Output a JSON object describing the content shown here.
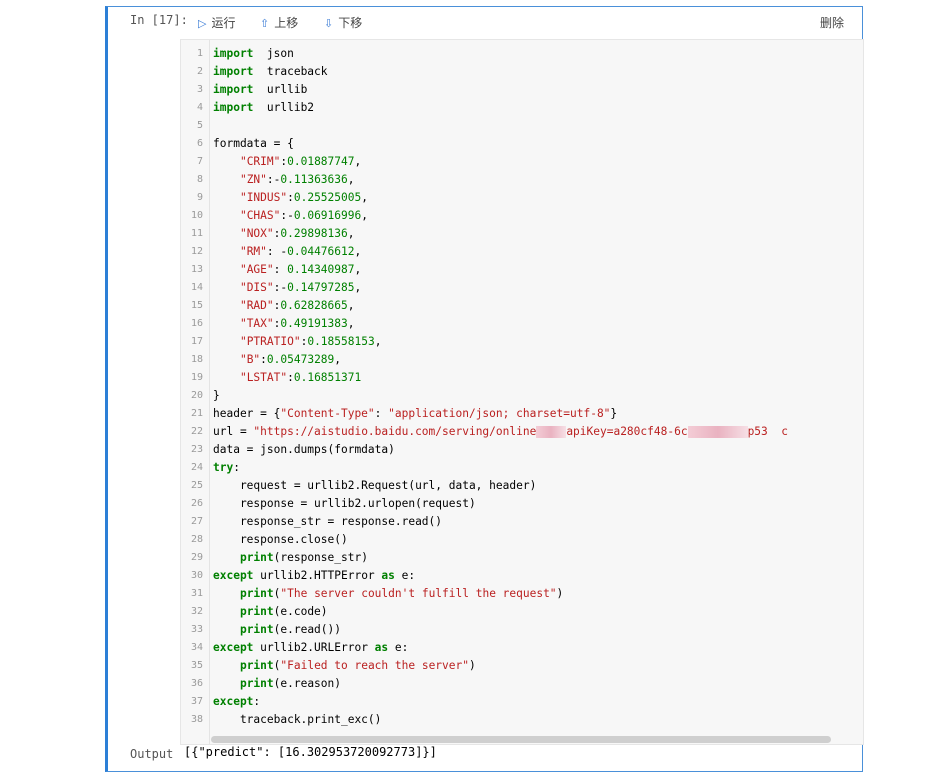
{
  "cell": {
    "in_prompt": "In [17]:",
    "out_prompt": "Output",
    "toolbar": {
      "run_label": "运行",
      "move_up_label": "上移",
      "move_down_label": "下移",
      "delete_label": "删除",
      "run_icon": "play-icon",
      "up_icon": "arrow-up-icon",
      "down_icon": "arrow-down-icon"
    },
    "output_text": "[{\"predict\": [16.302953720092773]}]"
  },
  "code_lines": [
    {
      "n": "1",
      "segs": [
        [
          "kw",
          "import"
        ],
        [
          "",
          "  json"
        ]
      ]
    },
    {
      "n": "2",
      "segs": [
        [
          "kw",
          "import"
        ],
        [
          "",
          "  traceback"
        ]
      ]
    },
    {
      "n": "3",
      "segs": [
        [
          "kw",
          "import"
        ],
        [
          "",
          "  urllib"
        ]
      ]
    },
    {
      "n": "4",
      "segs": [
        [
          "kw",
          "import"
        ],
        [
          "",
          "  urllib2"
        ]
      ]
    },
    {
      "n": "5",
      "segs": []
    },
    {
      "n": "6",
      "segs": [
        [
          "",
          "formdata = {"
        ]
      ]
    },
    {
      "n": "7",
      "segs": [
        [
          "",
          "    "
        ],
        [
          "str",
          "\"CRIM\""
        ],
        [
          "",
          ":"
        ],
        [
          "num",
          "0.01887747"
        ],
        [
          "",
          ","
        ]
      ]
    },
    {
      "n": "8",
      "segs": [
        [
          "",
          "    "
        ],
        [
          "str",
          "\"ZN\""
        ],
        [
          "",
          ":-"
        ],
        [
          "num",
          "0.11363636"
        ],
        [
          "",
          ","
        ]
      ]
    },
    {
      "n": "9",
      "segs": [
        [
          "",
          "    "
        ],
        [
          "str",
          "\"INDUS\""
        ],
        [
          "",
          ":"
        ],
        [
          "num",
          "0.25525005"
        ],
        [
          "",
          ","
        ]
      ]
    },
    {
      "n": "10",
      "segs": [
        [
          "",
          "    "
        ],
        [
          "str",
          "\"CHAS\""
        ],
        [
          "",
          ":-"
        ],
        [
          "num",
          "0.06916996"
        ],
        [
          "",
          ","
        ]
      ]
    },
    {
      "n": "11",
      "segs": [
        [
          "",
          "    "
        ],
        [
          "str",
          "\"NOX\""
        ],
        [
          "",
          ":"
        ],
        [
          "num",
          "0.29898136"
        ],
        [
          "",
          ","
        ]
      ]
    },
    {
      "n": "12",
      "segs": [
        [
          "",
          "    "
        ],
        [
          "str",
          "\"RM\""
        ],
        [
          "",
          ": -"
        ],
        [
          "num",
          "0.04476612"
        ],
        [
          "",
          ","
        ]
      ]
    },
    {
      "n": "13",
      "segs": [
        [
          "",
          "    "
        ],
        [
          "str",
          "\"AGE\""
        ],
        [
          "",
          ": "
        ],
        [
          "num",
          "0.14340987"
        ],
        [
          "",
          ","
        ]
      ]
    },
    {
      "n": "14",
      "segs": [
        [
          "",
          "    "
        ],
        [
          "str",
          "\"DIS\""
        ],
        [
          "",
          ":-"
        ],
        [
          "num",
          "0.14797285"
        ],
        [
          "",
          ","
        ]
      ]
    },
    {
      "n": "15",
      "segs": [
        [
          "",
          "    "
        ],
        [
          "str",
          "\"RAD\""
        ],
        [
          "",
          ":"
        ],
        [
          "num",
          "0.62828665"
        ],
        [
          "",
          ","
        ]
      ]
    },
    {
      "n": "16",
      "segs": [
        [
          "",
          "    "
        ],
        [
          "str",
          "\"TAX\""
        ],
        [
          "",
          ":"
        ],
        [
          "num",
          "0.49191383"
        ],
        [
          "",
          ","
        ]
      ]
    },
    {
      "n": "17",
      "segs": [
        [
          "",
          "    "
        ],
        [
          "str",
          "\"PTRATIO\""
        ],
        [
          "",
          ":"
        ],
        [
          "num",
          "0.18558153"
        ],
        [
          "",
          ","
        ]
      ]
    },
    {
      "n": "18",
      "segs": [
        [
          "",
          "    "
        ],
        [
          "str",
          "\"B\""
        ],
        [
          "",
          ":"
        ],
        [
          "num",
          "0.05473289"
        ],
        [
          "",
          ","
        ]
      ]
    },
    {
      "n": "19",
      "segs": [
        [
          "",
          "    "
        ],
        [
          "str",
          "\"LSTAT\""
        ],
        [
          "",
          ":"
        ],
        [
          "num",
          "0.16851371"
        ]
      ]
    },
    {
      "n": "20",
      "segs": [
        [
          "",
          "}"
        ]
      ]
    },
    {
      "n": "21",
      "segs": [
        [
          "",
          "header = {"
        ],
        [
          "str",
          "\"Content-Type\""
        ],
        [
          "",
          ": "
        ],
        [
          "str",
          "\"application/json; charset=utf-8\""
        ],
        [
          "",
          "}"
        ]
      ]
    },
    {
      "n": "22",
      "segs": [
        [
          "",
          "url = "
        ],
        [
          "str",
          "\"https://aistudio.baidu.com/serving/online"
        ],
        [
          "blur",
          ""
        ],
        [
          "str",
          "apiKey=a280cf48-6c"
        ],
        [
          "blur",
          ""
        ],
        [
          "str",
          "p53  c"
        ]
      ]
    },
    {
      "n": "23",
      "segs": [
        [
          "",
          "data = json.dumps(formdata)"
        ]
      ]
    },
    {
      "n": "24",
      "segs": [
        [
          "kw",
          "try"
        ],
        [
          "",
          ":"
        ]
      ]
    },
    {
      "n": "25",
      "segs": [
        [
          "",
          "    request = urllib2.Request(url, data, header)"
        ]
      ]
    },
    {
      "n": "26",
      "segs": [
        [
          "",
          "    response = urllib2.urlopen(request)"
        ]
      ]
    },
    {
      "n": "27",
      "segs": [
        [
          "",
          "    response_str = response.read()"
        ]
      ]
    },
    {
      "n": "28",
      "segs": [
        [
          "",
          "    response.close()"
        ]
      ]
    },
    {
      "n": "29",
      "segs": [
        [
          "",
          "    "
        ],
        [
          "kw",
          "print"
        ],
        [
          "",
          "(response_str)"
        ]
      ]
    },
    {
      "n": "30",
      "segs": [
        [
          "kw",
          "except"
        ],
        [
          "",
          " urllib2.HTTPError "
        ],
        [
          "kw",
          "as"
        ],
        [
          "",
          " e:"
        ]
      ]
    },
    {
      "n": "31",
      "segs": [
        [
          "",
          "    "
        ],
        [
          "kw",
          "print"
        ],
        [
          "",
          "("
        ],
        [
          "str",
          "\"The server couldn't fulfill the request\""
        ],
        [
          "",
          ")"
        ]
      ]
    },
    {
      "n": "32",
      "segs": [
        [
          "",
          "    "
        ],
        [
          "kw",
          "print"
        ],
        [
          "",
          "(e.code)"
        ]
      ]
    },
    {
      "n": "33",
      "segs": [
        [
          "",
          "    "
        ],
        [
          "kw",
          "print"
        ],
        [
          "",
          "(e.read())"
        ]
      ]
    },
    {
      "n": "34",
      "segs": [
        [
          "kw",
          "except"
        ],
        [
          "",
          " urllib2.URLError "
        ],
        [
          "kw",
          "as"
        ],
        [
          "",
          " e:"
        ]
      ]
    },
    {
      "n": "35",
      "segs": [
        [
          "",
          "    "
        ],
        [
          "kw",
          "print"
        ],
        [
          "",
          "("
        ],
        [
          "str",
          "\"Failed to reach the server\""
        ],
        [
          "",
          ")"
        ]
      ]
    },
    {
      "n": "36",
      "segs": [
        [
          "",
          "    "
        ],
        [
          "kw",
          "print"
        ],
        [
          "",
          "(e.reason)"
        ]
      ]
    },
    {
      "n": "37",
      "segs": [
        [
          "kw",
          "except"
        ],
        [
          "",
          ":"
        ]
      ]
    },
    {
      "n": "38",
      "segs": [
        [
          "",
          "    traceback.print_exc()"
        ]
      ]
    }
  ],
  "colors": {
    "cell_border": "#2c7fd6",
    "keyword": "#008000",
    "string": "#ba2121",
    "number": "#008000"
  }
}
